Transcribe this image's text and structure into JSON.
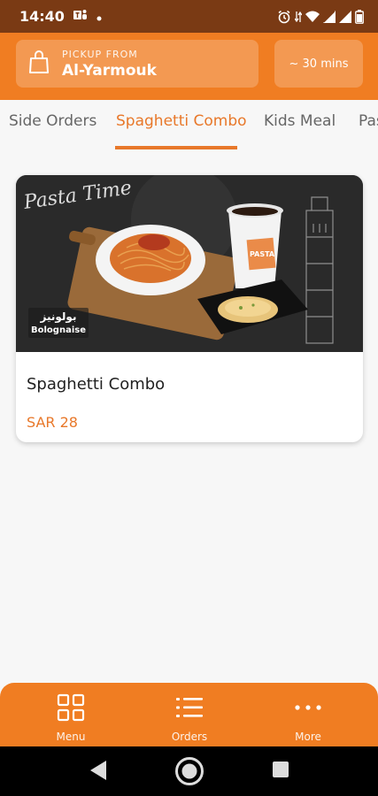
{
  "status_bar": {
    "time": "14:40",
    "icons": [
      "teams-icon",
      "dot-icon",
      "alarm-icon",
      "data-icon",
      "wifi-icon",
      "signal-icon",
      "signal-icon",
      "battery-icon"
    ]
  },
  "header": {
    "pickup_label": "PICKUP FROM",
    "pickup_location": "Al-Yarmouk",
    "eta": "~ 30 mins"
  },
  "tabs": [
    {
      "label": "Side Orders",
      "active": false
    },
    {
      "label": "Spaghetti Combo",
      "active": true
    },
    {
      "label": "Kids Meal",
      "active": false
    },
    {
      "label": "Pas",
      "active": false
    }
  ],
  "product": {
    "name": "Spaghetti Combo",
    "price": "SAR 28",
    "image_text": {
      "arabic": "بولونيز",
      "latin": "Bolognaise",
      "chalk": "Pasta Time",
      "cup": "PASTA"
    }
  },
  "bottom_nav": [
    {
      "label": "Menu",
      "icon": "grid-icon"
    },
    {
      "label": "Orders",
      "icon": "list-icon"
    },
    {
      "label": "More",
      "icon": "more-icon"
    }
  ],
  "colors": {
    "accent": "#f07d22",
    "status_bar": "#7a3a14",
    "active_tab": "#e8782a"
  }
}
